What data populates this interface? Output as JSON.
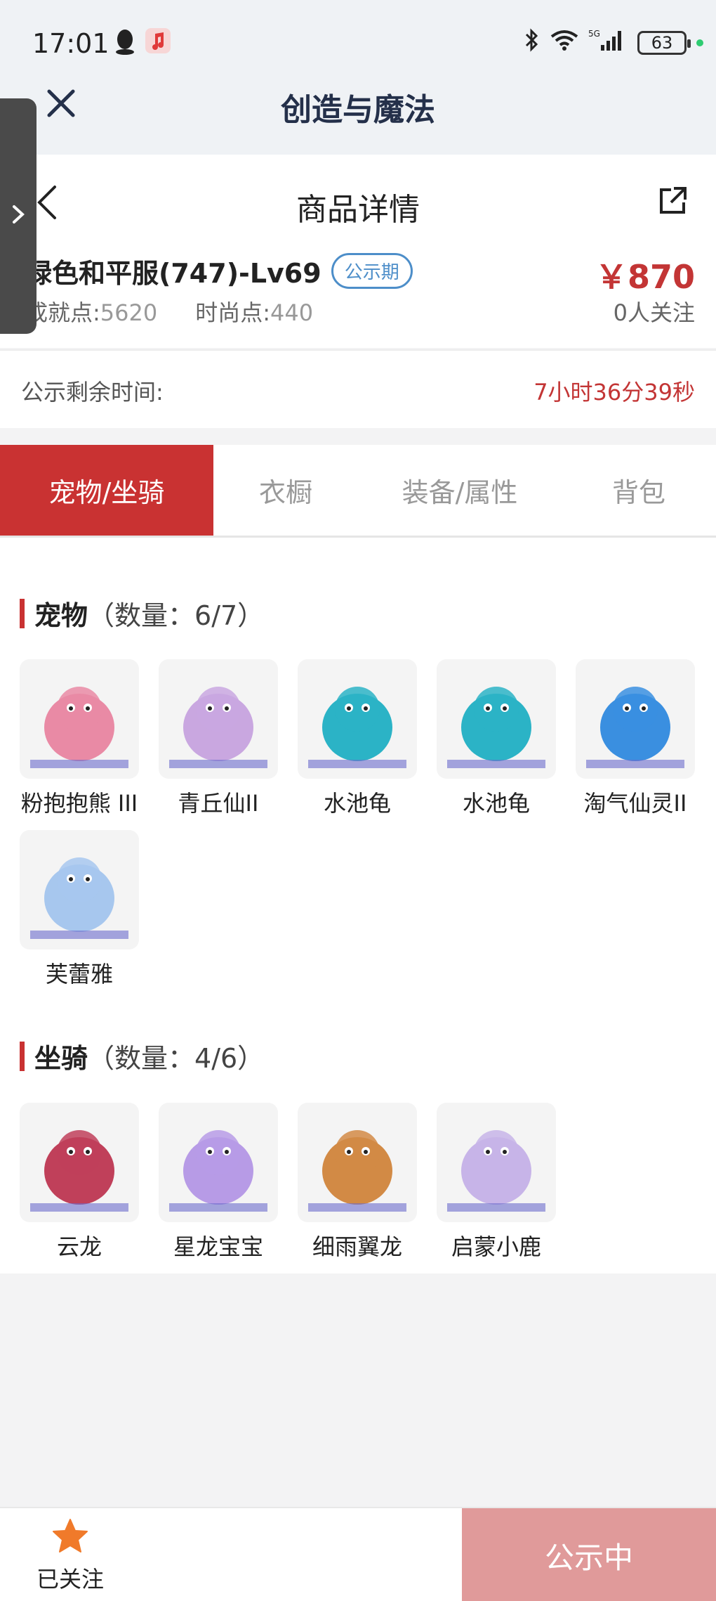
{
  "status": {
    "time": "17:01",
    "battery": "63"
  },
  "app": {
    "title": "创造与魔法"
  },
  "detail": {
    "title": "商品详情",
    "product_name": "绿色和平服(747)-Lv69",
    "badge": "公示期",
    "achievement_label": "成就点:",
    "achievement_value": "5620",
    "fashion_label": "时尚点:",
    "fashion_value": "440",
    "price": "￥870",
    "followers": "0人关注"
  },
  "notice": {
    "label": "公示剩余时间:",
    "remaining": "7小时36分39秒"
  },
  "tabs": [
    {
      "label": "宠物/坐骑"
    },
    {
      "label": "衣橱"
    },
    {
      "label": "装备/属性"
    },
    {
      "label": "背包"
    }
  ],
  "pets": {
    "title": "宠物",
    "count": "（数量：6/7）",
    "items": [
      {
        "name": "粉抱抱熊 III",
        "color": "#e98aa5"
      },
      {
        "name": "青丘仙II",
        "color": "#c9a7e0"
      },
      {
        "name": "水池龟",
        "color": "#2bb3c6"
      },
      {
        "name": "水池龟",
        "color": "#2bb3c6"
      },
      {
        "name": "淘气仙灵II",
        "color": "#3a8fe0"
      },
      {
        "name": "芙蕾雅",
        "color": "#a7c7ee"
      }
    ]
  },
  "mounts": {
    "title": "坐骑",
    "count": "（数量：4/6）",
    "items": [
      {
        "name": "云龙",
        "color": "#c0405a"
      },
      {
        "name": "星龙宝宝",
        "color": "#b79be6"
      },
      {
        "name": "细雨翼龙",
        "color": "#d28a45"
      },
      {
        "name": "启蒙小鹿",
        "color": "#c7b4e8"
      }
    ]
  },
  "bottom": {
    "follow_label": "已关注",
    "status_button": "公示中"
  }
}
